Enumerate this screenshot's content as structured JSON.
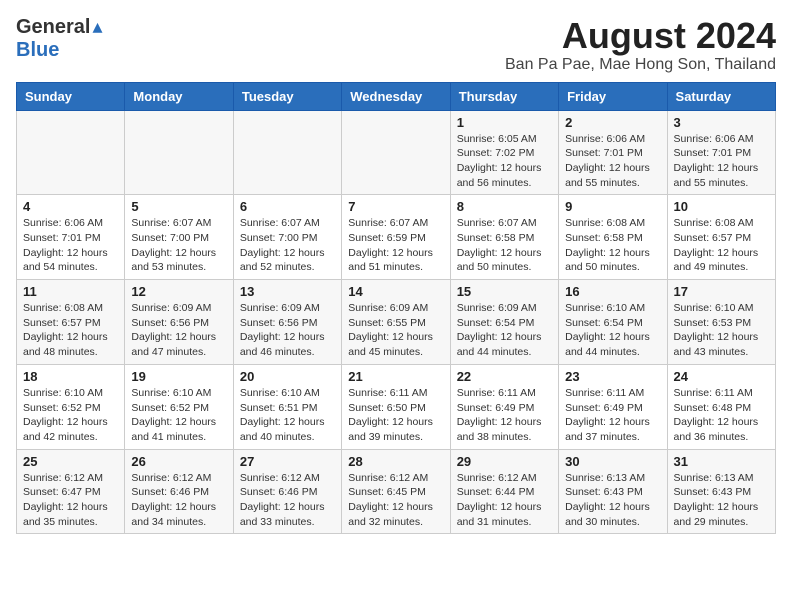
{
  "header": {
    "logo_general": "General",
    "logo_blue": "Blue",
    "month_title": "August 2024",
    "location": "Ban Pa Pae, Mae Hong Son, Thailand"
  },
  "weekdays": [
    "Sunday",
    "Monday",
    "Tuesday",
    "Wednesday",
    "Thursday",
    "Friday",
    "Saturday"
  ],
  "weeks": [
    [
      {
        "day": "",
        "info": ""
      },
      {
        "day": "",
        "info": ""
      },
      {
        "day": "",
        "info": ""
      },
      {
        "day": "",
        "info": ""
      },
      {
        "day": "1",
        "info": "Sunrise: 6:05 AM\nSunset: 7:02 PM\nDaylight: 12 hours\nand 56 minutes."
      },
      {
        "day": "2",
        "info": "Sunrise: 6:06 AM\nSunset: 7:01 PM\nDaylight: 12 hours\nand 55 minutes."
      },
      {
        "day": "3",
        "info": "Sunrise: 6:06 AM\nSunset: 7:01 PM\nDaylight: 12 hours\nand 55 minutes."
      }
    ],
    [
      {
        "day": "4",
        "info": "Sunrise: 6:06 AM\nSunset: 7:01 PM\nDaylight: 12 hours\nand 54 minutes."
      },
      {
        "day": "5",
        "info": "Sunrise: 6:07 AM\nSunset: 7:00 PM\nDaylight: 12 hours\nand 53 minutes."
      },
      {
        "day": "6",
        "info": "Sunrise: 6:07 AM\nSunset: 7:00 PM\nDaylight: 12 hours\nand 52 minutes."
      },
      {
        "day": "7",
        "info": "Sunrise: 6:07 AM\nSunset: 6:59 PM\nDaylight: 12 hours\nand 51 minutes."
      },
      {
        "day": "8",
        "info": "Sunrise: 6:07 AM\nSunset: 6:58 PM\nDaylight: 12 hours\nand 50 minutes."
      },
      {
        "day": "9",
        "info": "Sunrise: 6:08 AM\nSunset: 6:58 PM\nDaylight: 12 hours\nand 50 minutes."
      },
      {
        "day": "10",
        "info": "Sunrise: 6:08 AM\nSunset: 6:57 PM\nDaylight: 12 hours\nand 49 minutes."
      }
    ],
    [
      {
        "day": "11",
        "info": "Sunrise: 6:08 AM\nSunset: 6:57 PM\nDaylight: 12 hours\nand 48 minutes."
      },
      {
        "day": "12",
        "info": "Sunrise: 6:09 AM\nSunset: 6:56 PM\nDaylight: 12 hours\nand 47 minutes."
      },
      {
        "day": "13",
        "info": "Sunrise: 6:09 AM\nSunset: 6:56 PM\nDaylight: 12 hours\nand 46 minutes."
      },
      {
        "day": "14",
        "info": "Sunrise: 6:09 AM\nSunset: 6:55 PM\nDaylight: 12 hours\nand 45 minutes."
      },
      {
        "day": "15",
        "info": "Sunrise: 6:09 AM\nSunset: 6:54 PM\nDaylight: 12 hours\nand 44 minutes."
      },
      {
        "day": "16",
        "info": "Sunrise: 6:10 AM\nSunset: 6:54 PM\nDaylight: 12 hours\nand 44 minutes."
      },
      {
        "day": "17",
        "info": "Sunrise: 6:10 AM\nSunset: 6:53 PM\nDaylight: 12 hours\nand 43 minutes."
      }
    ],
    [
      {
        "day": "18",
        "info": "Sunrise: 6:10 AM\nSunset: 6:52 PM\nDaylight: 12 hours\nand 42 minutes."
      },
      {
        "day": "19",
        "info": "Sunrise: 6:10 AM\nSunset: 6:52 PM\nDaylight: 12 hours\nand 41 minutes."
      },
      {
        "day": "20",
        "info": "Sunrise: 6:10 AM\nSunset: 6:51 PM\nDaylight: 12 hours\nand 40 minutes."
      },
      {
        "day": "21",
        "info": "Sunrise: 6:11 AM\nSunset: 6:50 PM\nDaylight: 12 hours\nand 39 minutes."
      },
      {
        "day": "22",
        "info": "Sunrise: 6:11 AM\nSunset: 6:49 PM\nDaylight: 12 hours\nand 38 minutes."
      },
      {
        "day": "23",
        "info": "Sunrise: 6:11 AM\nSunset: 6:49 PM\nDaylight: 12 hours\nand 37 minutes."
      },
      {
        "day": "24",
        "info": "Sunrise: 6:11 AM\nSunset: 6:48 PM\nDaylight: 12 hours\nand 36 minutes."
      }
    ],
    [
      {
        "day": "25",
        "info": "Sunrise: 6:12 AM\nSunset: 6:47 PM\nDaylight: 12 hours\nand 35 minutes."
      },
      {
        "day": "26",
        "info": "Sunrise: 6:12 AM\nSunset: 6:46 PM\nDaylight: 12 hours\nand 34 minutes."
      },
      {
        "day": "27",
        "info": "Sunrise: 6:12 AM\nSunset: 6:46 PM\nDaylight: 12 hours\nand 33 minutes."
      },
      {
        "day": "28",
        "info": "Sunrise: 6:12 AM\nSunset: 6:45 PM\nDaylight: 12 hours\nand 32 minutes."
      },
      {
        "day": "29",
        "info": "Sunrise: 6:12 AM\nSunset: 6:44 PM\nDaylight: 12 hours\nand 31 minutes."
      },
      {
        "day": "30",
        "info": "Sunrise: 6:13 AM\nSunset: 6:43 PM\nDaylight: 12 hours\nand 30 minutes."
      },
      {
        "day": "31",
        "info": "Sunrise: 6:13 AM\nSunset: 6:43 PM\nDaylight: 12 hours\nand 29 minutes."
      }
    ]
  ]
}
